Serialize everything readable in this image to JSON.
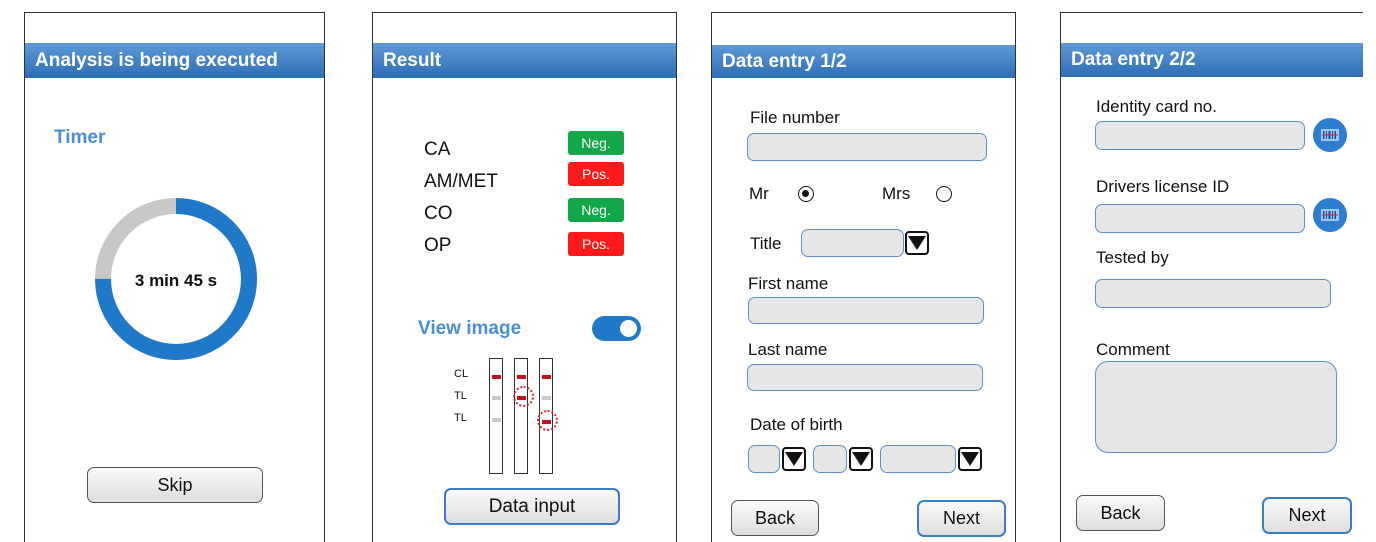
{
  "screen1": {
    "header": "Analysis is being executed",
    "timer_label": "Timer",
    "timer_value": "3 min 45 s",
    "progress_fraction": 0.75,
    "skip_label": "Skip"
  },
  "screen2": {
    "header": "Result",
    "results": [
      {
        "name": "CA",
        "status": "Neg.",
        "color": "#12a84a"
      },
      {
        "name": "AM/MET",
        "status": "Pos.",
        "color": "#ff1a1a"
      },
      {
        "name": "CO",
        "status": "Neg.",
        "color": "#12a84a"
      },
      {
        "name": "OP",
        "status": "Pos.",
        "color": "#ff1a1a"
      }
    ],
    "view_image_label": "View image",
    "view_image_on": true,
    "strip_labels": [
      "CL",
      "TL",
      "TL"
    ],
    "data_input_label": "Data input"
  },
  "screen3": {
    "header": "Data entry 1/2",
    "file_number_label": "File number",
    "mr_label": "Mr",
    "mrs_label": "Mrs",
    "selected_salutation": "Mr",
    "title_label": "Title",
    "first_name_label": "First name",
    "last_name_label": "Last name",
    "dob_label": "Date of birth",
    "back_label": "Back",
    "next_label": "Next"
  },
  "screen4": {
    "header": "Data entry 2/2",
    "identity_label": "Identity card no.",
    "drivers_license_label": "Drivers license ID",
    "tested_by_label": "Tested by",
    "comment_label": "Comment",
    "back_label": "Back",
    "next_label": "Next"
  },
  "colors": {
    "header_blue": "#2f6db4",
    "accent_blue": "#4a8fd6",
    "progress_blue": "#1f78c8",
    "progress_track": "#c8c8c8",
    "negative_green": "#12a84a",
    "positive_red": "#ff1a1a"
  },
  "icons": [
    "barcode-scan-icon",
    "dropdown-arrow-icon",
    "toggle-switch"
  ]
}
